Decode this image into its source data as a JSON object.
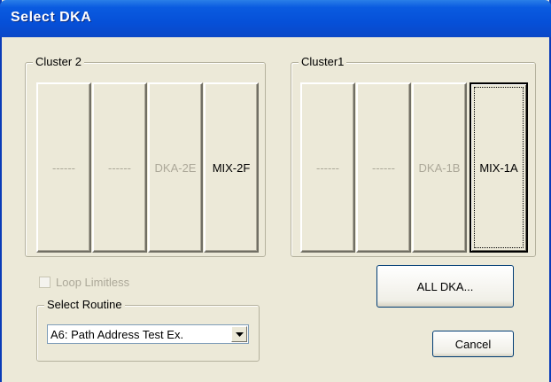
{
  "window": {
    "title": "Select DKA"
  },
  "cluster2": {
    "label": "Cluster 2",
    "tiles": [
      {
        "label": "------",
        "state": "disabled"
      },
      {
        "label": "------",
        "state": "disabled"
      },
      {
        "label": "DKA-2E",
        "state": "disabled"
      },
      {
        "label": "MIX-2F",
        "state": "enabled"
      }
    ]
  },
  "cluster1": {
    "label": "Cluster1",
    "tiles": [
      {
        "label": "------",
        "state": "disabled"
      },
      {
        "label": "------",
        "state": "disabled"
      },
      {
        "label": "DKA-1B",
        "state": "disabled"
      },
      {
        "label": "MIX-1A",
        "state": "selected"
      }
    ]
  },
  "loop_limitless": {
    "label": "Loop Limitless",
    "checked": false,
    "enabled": false
  },
  "select_routine": {
    "label": "Select Routine",
    "value": "A6: Path Address Test Ex."
  },
  "buttons": {
    "all_dka": "ALL DKA...",
    "cancel": "Cancel"
  },
  "icons": {
    "dropdown": "chevron-down-icon",
    "checkbox": "checkbox-icon"
  },
  "colors": {
    "titlebar": "#0650d8",
    "face": "#ece9d8",
    "disabled_text": "#aca899"
  }
}
